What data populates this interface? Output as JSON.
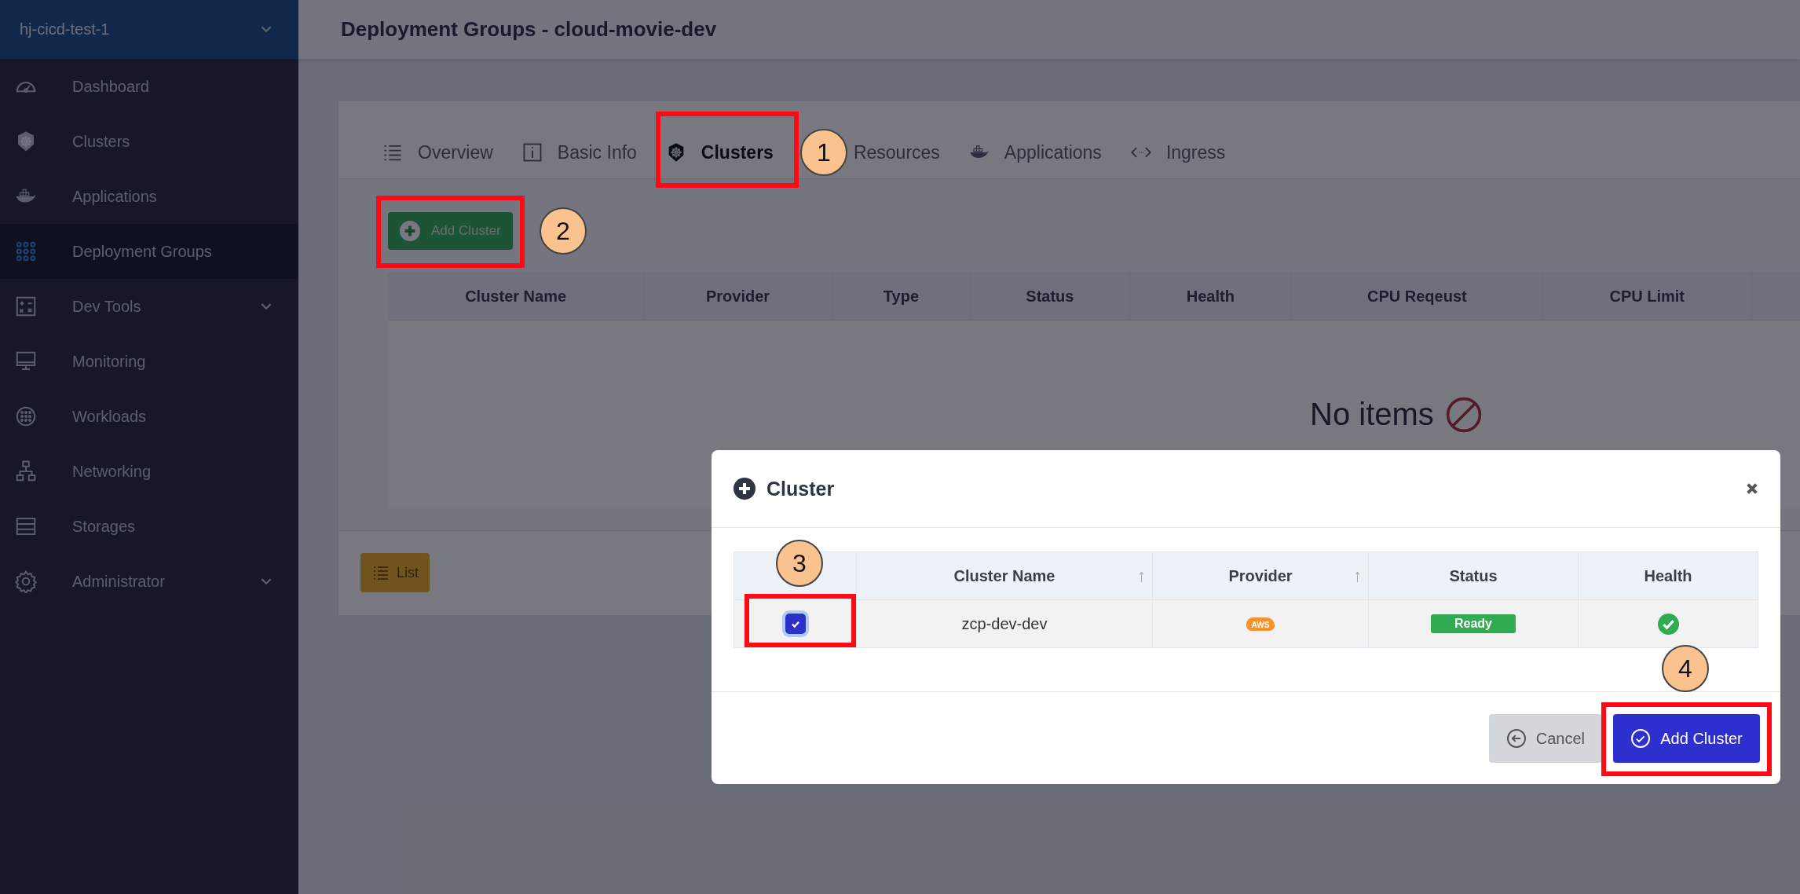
{
  "sidebar": {
    "project": "hj-cicd-test-1",
    "items": [
      {
        "label": "Dashboard",
        "selected": false,
        "expandable": false
      },
      {
        "label": "Clusters",
        "selected": false,
        "expandable": false
      },
      {
        "label": "Applications",
        "selected": false,
        "expandable": false
      },
      {
        "label": "Deployment Groups",
        "selected": true,
        "expandable": false
      },
      {
        "label": "Dev Tools",
        "selected": false,
        "expandable": true
      },
      {
        "label": "Monitoring",
        "selected": false,
        "expandable": false
      },
      {
        "label": "Workloads",
        "selected": false,
        "expandable": false
      },
      {
        "label": "Networking",
        "selected": false,
        "expandable": false
      },
      {
        "label": "Storages",
        "selected": false,
        "expandable": false
      },
      {
        "label": "Administrator",
        "selected": false,
        "expandable": true
      }
    ]
  },
  "page_title": "Deployment Groups - cloud-movie-dev",
  "tabs": [
    {
      "label": "Overview",
      "selected": false
    },
    {
      "label": "Basic Info",
      "selected": false
    },
    {
      "label": "Clusters",
      "selected": true,
      "callout": "1"
    },
    {
      "label": "Resources",
      "selected": false
    },
    {
      "label": "Applications",
      "selected": false
    },
    {
      "label": "Ingress",
      "selected": false
    }
  ],
  "add_button": {
    "label": "Add Cluster",
    "callout": "2"
  },
  "table": {
    "columns": [
      "Cluster Name",
      "Provider",
      "Type",
      "Status",
      "Health",
      "CPU Reqeust",
      "CPU Limit"
    ],
    "empty_message": "No items"
  },
  "list_button": "List",
  "modal": {
    "title": "Cluster",
    "columns": [
      {
        "label": "Cluster Name",
        "sort": "↑"
      },
      {
        "label": "Provider",
        "sort": "↑"
      },
      {
        "label": "Status"
      },
      {
        "label": "Health"
      }
    ],
    "rows": [
      {
        "checked": true,
        "callout": "3",
        "name": "zcp-dev-dev",
        "provider_logo": "AWS",
        "status": "Ready",
        "healthy": true
      }
    ],
    "cancel": "Cancel",
    "confirm": {
      "label": "Add Cluster",
      "callout": "4"
    }
  }
}
